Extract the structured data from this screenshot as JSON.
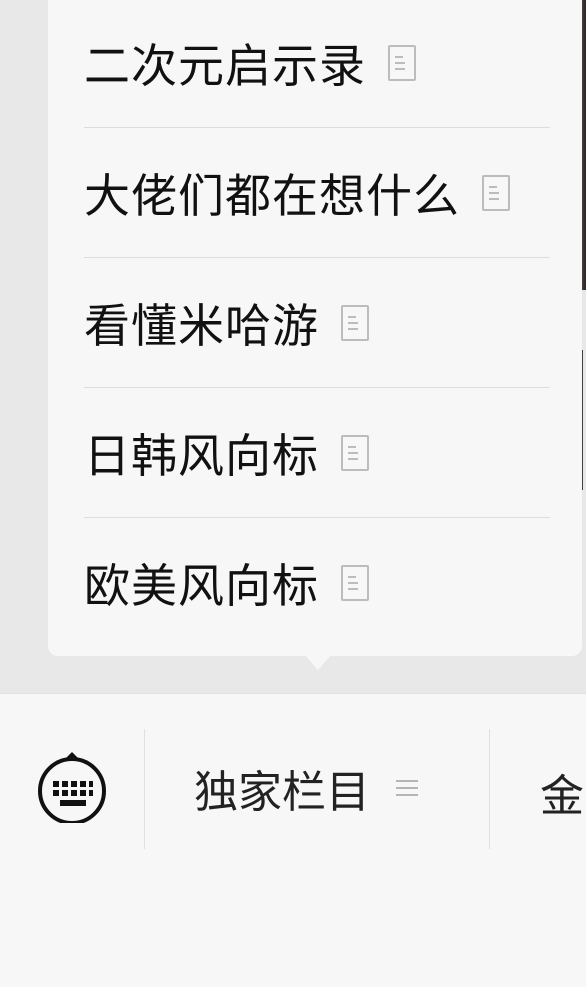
{
  "popup_menu": {
    "items": [
      {
        "label": "二次元启示录",
        "icon": "document-icon"
      },
      {
        "label": "大佬们都在想什么",
        "icon": "document-icon"
      },
      {
        "label": "看懂米哈游",
        "icon": "document-icon"
      },
      {
        "label": "日韩风向标",
        "icon": "document-icon"
      },
      {
        "label": "欧美风向标",
        "icon": "document-icon"
      }
    ]
  },
  "bottom_bar": {
    "keyboard_icon": "keyboard-toggle-icon",
    "tabs": [
      {
        "label": "独家栏目",
        "icon": "menu-lines-icon"
      },
      {
        "label": "金"
      }
    ]
  },
  "colors": {
    "popup_bg": "#f7f7f7",
    "overlay_bg": "#e8e8e8",
    "text": "#111111",
    "icon_gray": "#bcbcbc"
  }
}
